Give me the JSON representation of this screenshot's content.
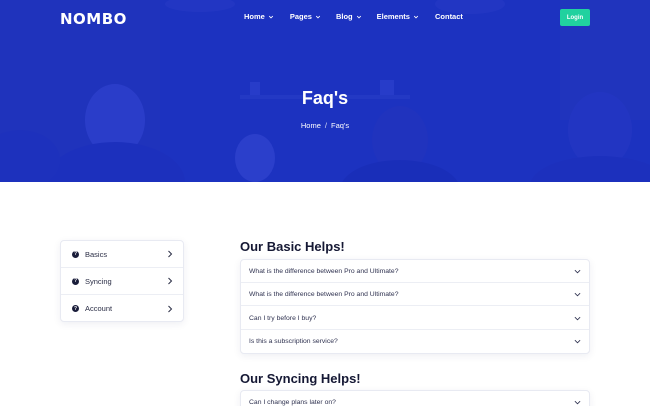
{
  "nav": {
    "logo": "NOMBO",
    "items": [
      {
        "label": "Home",
        "dropdown": true
      },
      {
        "label": "Pages",
        "dropdown": true
      },
      {
        "label": "Blog",
        "dropdown": true
      },
      {
        "label": "Elements",
        "dropdown": true
      },
      {
        "label": "Contact",
        "dropdown": false
      }
    ],
    "login_label": "Login"
  },
  "hero": {
    "title": "Faq's",
    "breadcrumb": [
      "Home",
      "Faq's"
    ],
    "breadcrumb_separator": "/"
  },
  "sidebar": {
    "items": [
      {
        "label": "Basics",
        "icon": "question-icon"
      },
      {
        "label": "Syncing",
        "icon": "question-icon"
      },
      {
        "label": "Account",
        "icon": "question-icon"
      }
    ]
  },
  "sections": [
    {
      "title": "Our Basic Helps!",
      "questions": [
        "What is the difference between Pro and Ultimate?",
        "What is the difference between Pro and Ultimate?",
        "Can I try before I buy?",
        "Is this a subscription service?"
      ]
    },
    {
      "title": "Our Syncing Helps!",
      "questions": [
        "Can I change plans later on?"
      ]
    }
  ],
  "colors": {
    "hero_overlay": "#1830ce",
    "accent_green": "#21d19f",
    "heading": "#151834"
  }
}
